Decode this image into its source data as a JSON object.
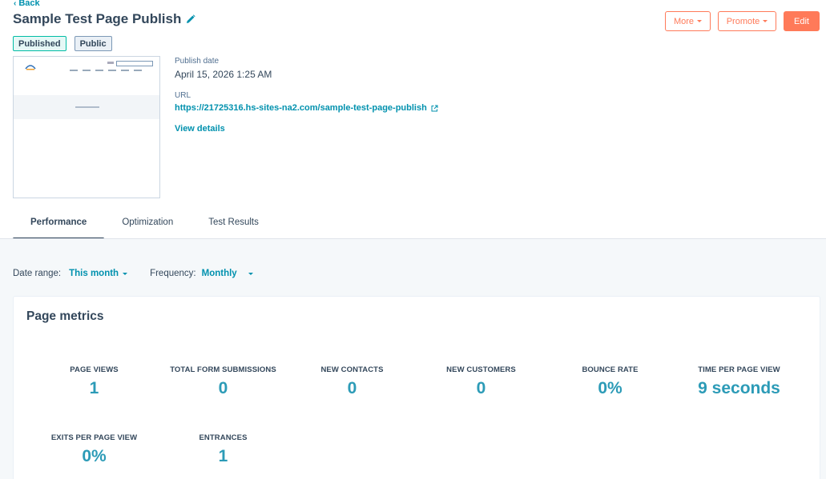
{
  "header": {
    "back_label": "Back",
    "title": "Sample Test Page Publish",
    "badges": [
      "Published",
      "Public"
    ],
    "buttons": {
      "more": "More",
      "promote": "Promote",
      "edit": "Edit"
    }
  },
  "details": {
    "publish_date_label": "Publish date",
    "publish_date": "April 15, 2026 1:25 AM",
    "url_label": "URL",
    "url": "https://21725316.hs-sites-na2.com/sample-test-page-publish",
    "view_details": "View details"
  },
  "tabs": [
    {
      "label": "Performance",
      "active": true
    },
    {
      "label": "Optimization",
      "active": false
    },
    {
      "label": "Test Results",
      "active": false
    }
  ],
  "filters": {
    "date_range_label": "Date range:",
    "date_range_value": "This month",
    "frequency_label": "Frequency:",
    "frequency_value": "Monthly"
  },
  "metrics_card": {
    "title": "Page metrics",
    "metrics": [
      {
        "label": "PAGE VIEWS",
        "value": "1"
      },
      {
        "label": "TOTAL FORM SUBMISSIONS",
        "value": "0"
      },
      {
        "label": "NEW CONTACTS",
        "value": "0"
      },
      {
        "label": "NEW CUSTOMERS",
        "value": "0"
      },
      {
        "label": "BOUNCE RATE",
        "value": "0%"
      },
      {
        "label": "TIME PER PAGE VIEW",
        "value": "9 seconds"
      },
      {
        "label": "EXITS PER PAGE VIEW",
        "value": "0%"
      },
      {
        "label": "ENTRANCES",
        "value": "1"
      }
    ]
  },
  "colors": {
    "accent_orange": "#ff7a59",
    "link_teal": "#0091ae",
    "metric_value": "#2c9bb7",
    "text_dark": "#33475b"
  }
}
